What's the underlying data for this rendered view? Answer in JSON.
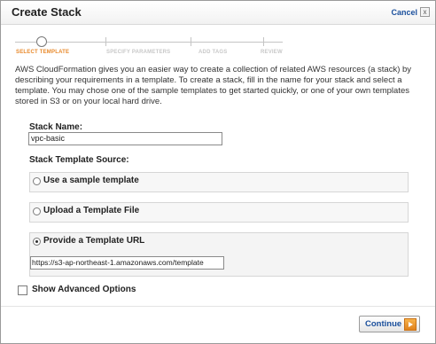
{
  "dialog": {
    "title": "Create Stack",
    "cancel_label": "Cancel",
    "close_glyph": "x"
  },
  "wizard": {
    "steps": [
      {
        "label": "SELECT TEMPLATE",
        "active": true
      },
      {
        "label": "SPECIFY PARAMETERS",
        "active": false
      },
      {
        "label": "ADD TAGS",
        "active": false
      },
      {
        "label": "REVIEW",
        "active": false
      }
    ]
  },
  "description": "AWS CloudFormation gives you an easier way to create a collection of related AWS resources (a stack) by describing your requirements in a template. To create a stack, fill in the name for your stack and select a template. You may chose one of the sample templates to get started quickly, or one of your own templates stored in S3 or on your local hard drive.",
  "form": {
    "stack_name_label": "Stack Name:",
    "stack_name_value": "vpc-basic",
    "source_label": "Stack Template Source:",
    "options": [
      {
        "label": "Use a sample template",
        "selected": false
      },
      {
        "label": "Upload a Template File",
        "selected": false
      },
      {
        "label": "Provide a Template URL",
        "selected": true
      }
    ],
    "template_url": "https://s3-ap-northeast-1.amazonaws.com/template",
    "advanced_label": "Show Advanced Options",
    "advanced_checked": false
  },
  "footer": {
    "continue_label": "Continue"
  },
  "colors": {
    "active_step": "#e8892b",
    "link": "#1a4f9c",
    "continue_arrow": "#f0a03a"
  }
}
